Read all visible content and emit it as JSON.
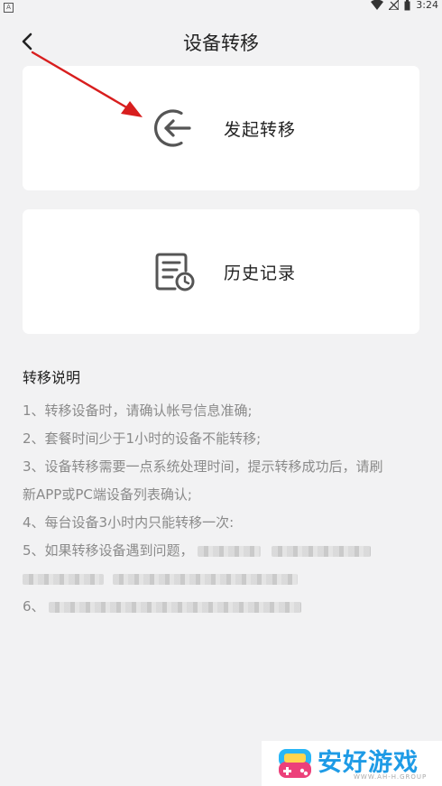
{
  "status_bar": {
    "sim_label": "A",
    "time": "3:24"
  },
  "header": {
    "title": "设备转移"
  },
  "cards": {
    "transfer": {
      "label": "发起转移",
      "icon": "transfer-back-arrow-icon"
    },
    "history": {
      "label": "历史记录",
      "icon": "history-record-icon"
    }
  },
  "notes": {
    "title": "转移说明",
    "items": [
      "1、转移设备时，请确认帐号信息准确;",
      "2、套餐时间少于1小时的设备不能转移;",
      "3、设备转移需要一点系统处理时间，提示转移成功后，请刷",
      "新APP或PC端设备列表确认;",
      "4、每台设备3小时内只能转移一次:",
      "5、如果转移设备遇到问题，",
      "6、"
    ]
  },
  "watermark": {
    "brand": "安好游戏",
    "sub": "WWW.AH-H.GROUP"
  },
  "colors": {
    "background": "#f2f2f3",
    "card": "#ffffff",
    "annotation_arrow": "#d81e1e",
    "watermark_blue": "#1e9be6"
  }
}
